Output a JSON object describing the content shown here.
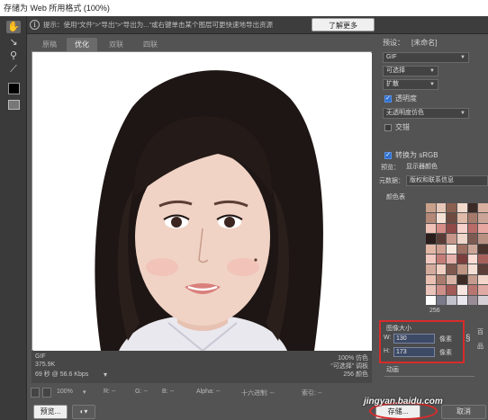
{
  "window": {
    "title": "存储为 Web 所用格式 (100%)"
  },
  "hint": {
    "icon": "i",
    "text": "提示：使用“文件”>“导出”>“导出为...”或右键单击某个图层可更快速地导出资源",
    "learn_more": "了解更多"
  },
  "tabs": [
    "原稿",
    "优化",
    "双联",
    "四联"
  ],
  "tools": [
    "hand-icon",
    "slice-select-icon",
    "zoom-icon",
    "eyedropper-icon"
  ],
  "canvas_info": {
    "format": "GIF",
    "size": "375.9K",
    "time": "69 秒 @ 56.6 Kbps",
    "quality": "100% 仿色",
    "palette": "“可选择” 调板",
    "colors": "256 颜色"
  },
  "statusbar": {
    "zoom": "100%",
    "r": "R: --",
    "g": "G: --",
    "b": "B: --",
    "alpha": "Alpha: --",
    "hex": "十六进制: --",
    "index": "索引: --"
  },
  "buttons": {
    "preview": "预览...",
    "save": "存储...",
    "cancel": "取消"
  },
  "right_panel": {
    "preset_label": "预设：",
    "preset_value": "[未命名]",
    "format": "GIF",
    "reduction": "可选择",
    "dither_algo": "扩散",
    "transparency_label": "透明度",
    "transparency_dither": "无透明度仿色",
    "interlace_label": "交错",
    "convert_srgb": "转换为 sRGB",
    "preview_label": "预览：",
    "preview_value": "显示器颜色",
    "metadata_label": "元数据：",
    "metadata_value": "版权和联系信息",
    "color_table_label": "颜色表",
    "color_count": "256",
    "image_size_label": "图像大小",
    "width_label": "W:",
    "width_value": "130",
    "height_label": "H:",
    "height_value": "173",
    "unit": "像素",
    "percent_label": "百",
    "quality_label": "品",
    "animation_label": "动画"
  },
  "watermark": "jingyan.baidu.com",
  "colors": {
    "panel_bg": "#535353",
    "highlight": "#d92b2b",
    "accent": "#2d6fd0"
  },
  "palette_colors": [
    "#c9a08a",
    "#e7c8b8",
    "#8a5f50",
    "#f1d9cc",
    "#3b2a25",
    "#d9b0a0",
    "#b38877",
    "#f5e2d6",
    "#6e4a40",
    "#e0bba9",
    "#a57a6b",
    "#caa497",
    "#f0c2b7",
    "#d68d88",
    "#914a48",
    "#f7d1cb",
    "#b86b67",
    "#e8a7a0",
    "#2a1d1b",
    "#5a3c36",
    "#c7968a",
    "#eed6ca",
    "#7e5b52",
    "#b99183",
    "#e3b7a6",
    "#d1a294",
    "#f8e8de",
    "#9c6f61",
    "#cba698",
    "#4a322d",
    "#f2c9c0",
    "#c57c76",
    "#e6b1aa",
    "#7c3f3c",
    "#fadcd4",
    "#a8605b",
    "#d4aa9c",
    "#efd0c3",
    "#80594e",
    "#bf9584",
    "#f6e0d6",
    "#5c3f38",
    "#e9c0b1",
    "#a97b6c",
    "#d8b4a6",
    "#3f2b26",
    "#c49b8d",
    "#f3d7cb",
    "#eac4bb",
    "#cf8f89",
    "#a15a56",
    "#f9e5df",
    "#b87570",
    "#deaaa3",
    "#ffffff",
    "#7a7a8a",
    "#c2c2cc",
    "#e9e6ee",
    "#9a8c96",
    "#d6cfd6"
  ]
}
